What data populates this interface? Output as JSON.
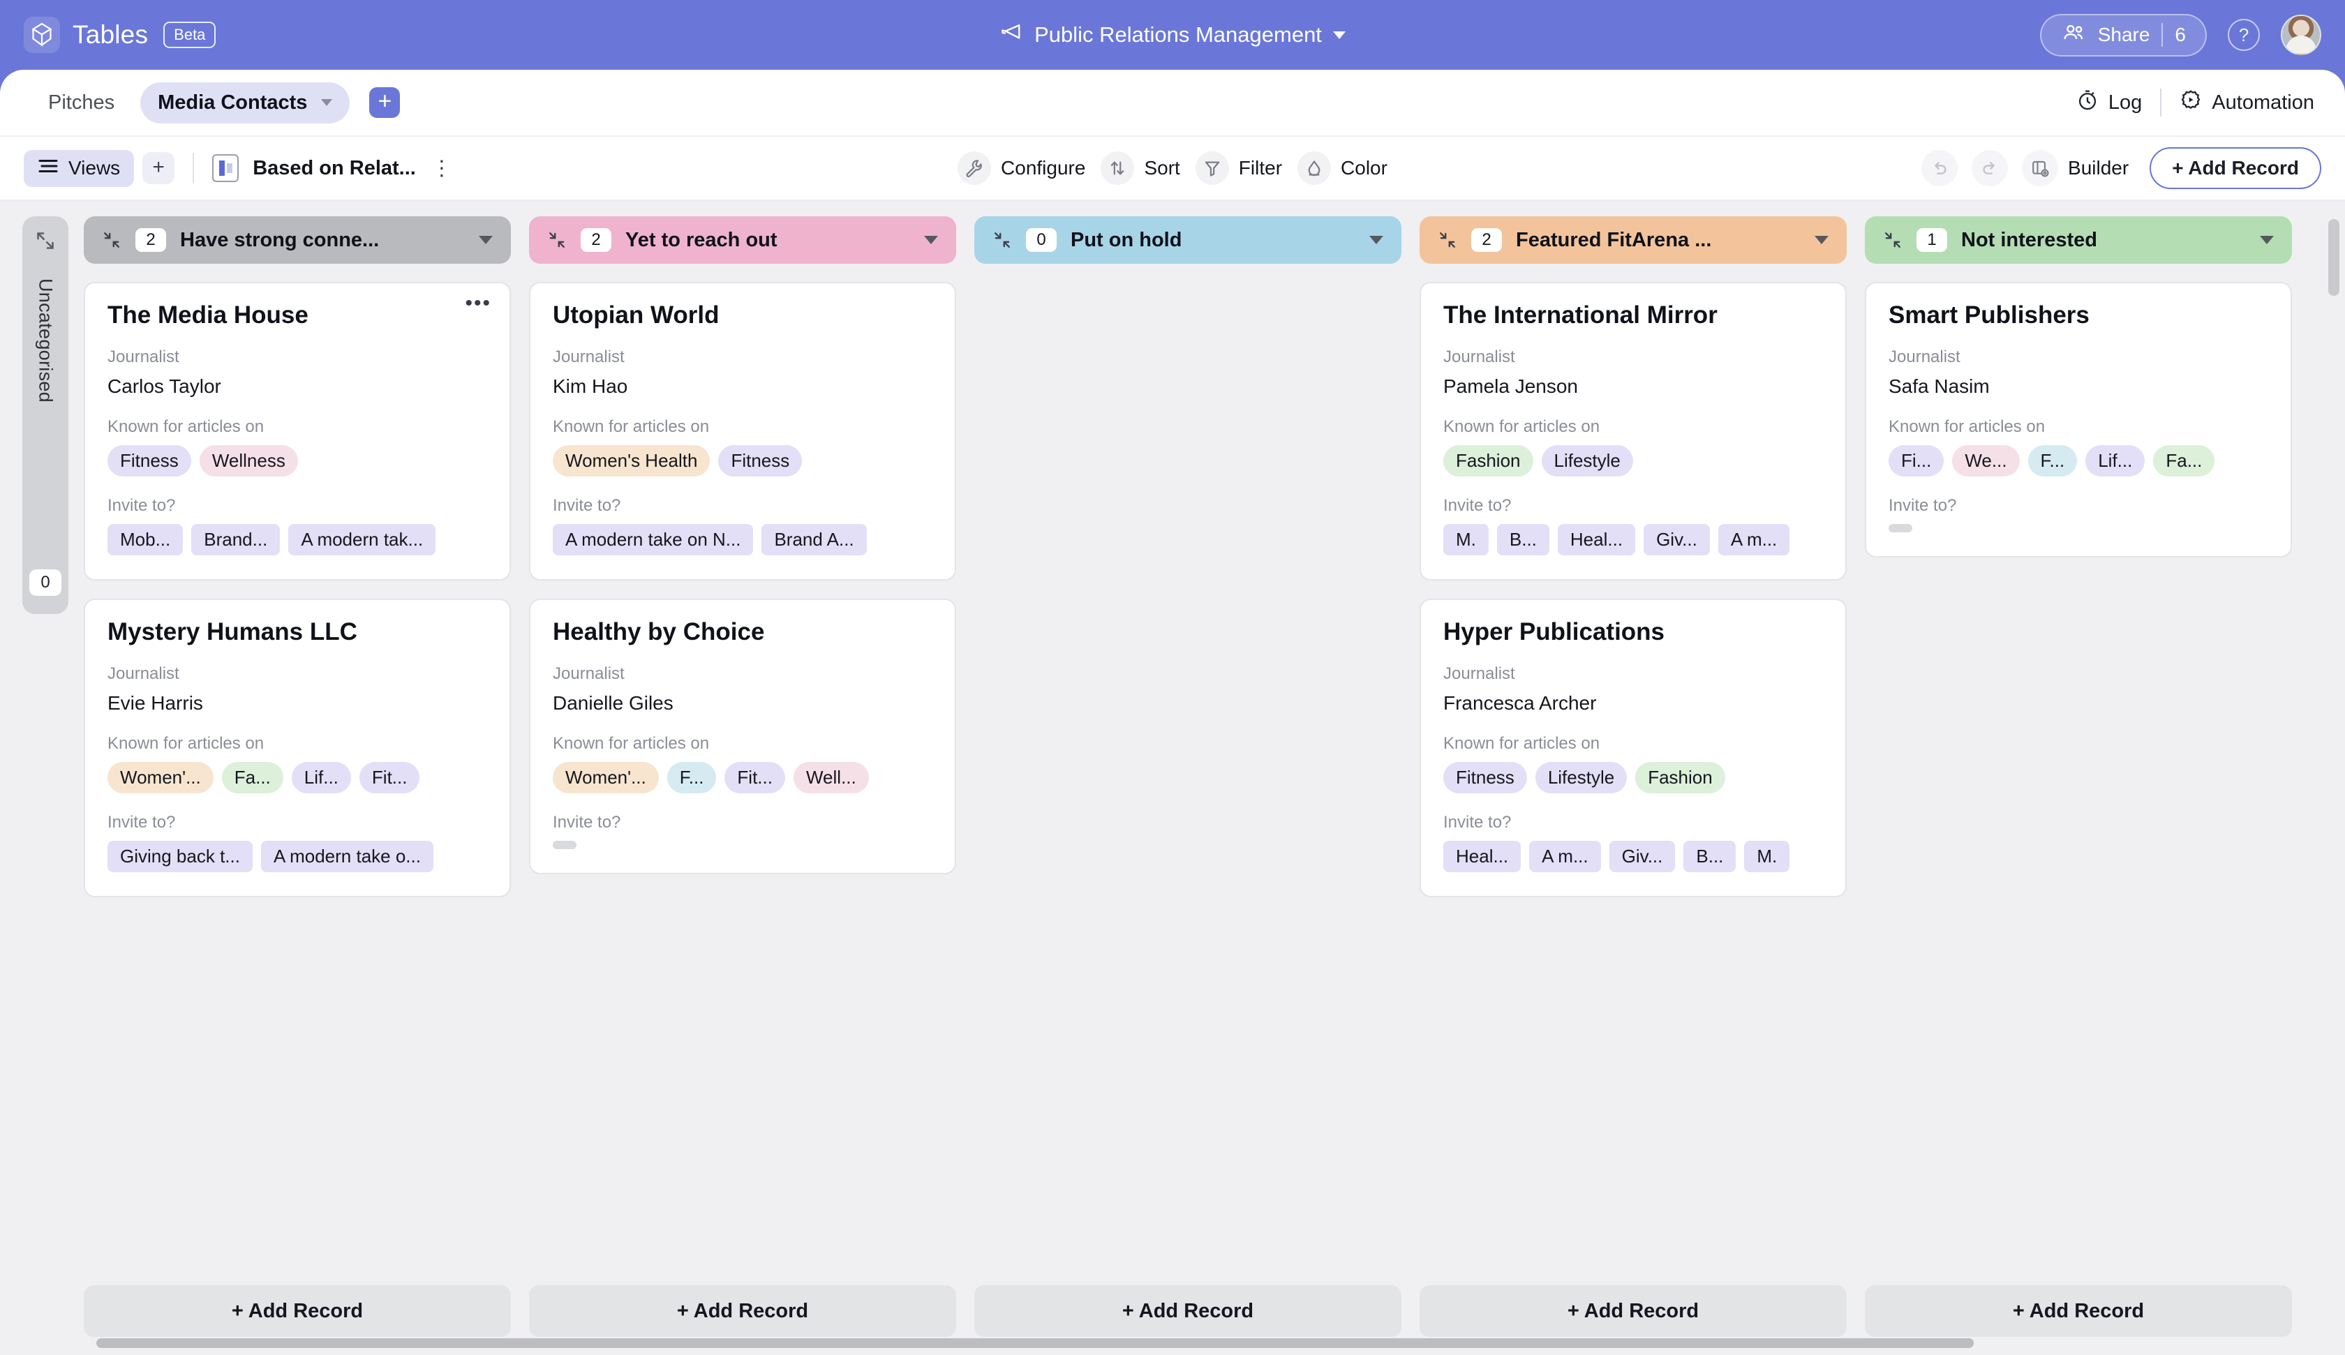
{
  "header": {
    "brand": "Tables",
    "beta": "Beta",
    "logo_icon": "cube-logo-icon",
    "doc_title": "Public Relations Management",
    "doc_icon": "megaphone-icon",
    "share_label": "Share",
    "share_count": "6",
    "share_icon": "people-icon",
    "help_icon": "question-mark-icon",
    "avatar_icon": "user-avatar"
  },
  "tabs": {
    "items": [
      {
        "label": "Pitches",
        "active": false
      },
      {
        "label": "Media Contacts",
        "active": true
      }
    ],
    "add_tab_icon": "plus-icon",
    "right": [
      {
        "label": "Log",
        "icon": "stopwatch-icon"
      },
      {
        "label": "Automation",
        "icon": "gear-play-icon"
      }
    ]
  },
  "toolbar": {
    "views_label": "Views",
    "views_icon": "hamburger-icon",
    "add_view_icon": "plus-icon",
    "current_view": "Based on Relat...",
    "view_icon": "kanban-icon",
    "view_menu_icon": "kebab-menu-icon",
    "center": [
      {
        "label": "Configure",
        "icon": "wrench-icon"
      },
      {
        "label": "Sort",
        "icon": "sort-arrows-icon"
      },
      {
        "label": "Filter",
        "icon": "funnel-icon"
      },
      {
        "label": "Color",
        "icon": "paint-drop-icon"
      }
    ],
    "undo_icon": "undo-arrow-icon",
    "redo_icon": "redo-arrow-icon",
    "builder_label": "Builder",
    "builder_icon": "builder-panel-icon",
    "add_record_label": "+ Add Record"
  },
  "board": {
    "add_record_label": "+ Add Record",
    "collapse_icon": "collapse-arrows-icon",
    "expand_icon": "expand-arrows-icon",
    "card_menu_icon": "ellipsis-icon",
    "collapsed_column": {
      "title": "Uncategorised",
      "count": "0"
    },
    "field_labels": {
      "journalist": "Journalist",
      "known_for": "Known for articles on",
      "invite_to": "Invite to?"
    },
    "columns": [
      {
        "title": "Have strong conne...",
        "count": "2",
        "color": "#b9babd",
        "cards": [
          {
            "title": "The Media House",
            "journalist": "Carlos Taylor",
            "known_for": [
              {
                "text": "Fitness",
                "color": "#e3dff7"
              },
              {
                "text": "Wellness",
                "color": "#f6e0e8"
              }
            ],
            "invite_to": [
              {
                "text": "Mob...",
                "color": "#e3dff7"
              },
              {
                "text": "Brand...",
                "color": "#e3dff7"
              },
              {
                "text": "A modern tak...",
                "color": "#e3dff7"
              }
            ]
          },
          {
            "title": "Mystery Humans LLC",
            "journalist": "Evie Harris",
            "known_for": [
              {
                "text": "Women'...",
                "color": "#f8e5cf"
              },
              {
                "text": "Fa...",
                "color": "#dcf0da"
              },
              {
                "text": "Lif...",
                "color": "#e3dff7"
              },
              {
                "text": "Fit...",
                "color": "#e3dff7"
              }
            ],
            "invite_to": [
              {
                "text": "Giving back t...",
                "color": "#e3dff7"
              },
              {
                "text": "A modern take o...",
                "color": "#e3dff7"
              }
            ]
          }
        ]
      },
      {
        "title": "Yet to reach out",
        "count": "2",
        "color": "#efb3cd",
        "cards": [
          {
            "title": "Utopian World",
            "journalist": "Kim Hao",
            "known_for": [
              {
                "text": "Women's Health",
                "color": "#f8e5cf"
              },
              {
                "text": "Fitness",
                "color": "#e3dff7"
              }
            ],
            "invite_to": [
              {
                "text": "A modern take on N...",
                "color": "#e3dff7"
              },
              {
                "text": "Brand A...",
                "color": "#e3dff7"
              }
            ]
          },
          {
            "title": "Healthy by Choice",
            "journalist": "Danielle Giles",
            "known_for": [
              {
                "text": "Women'...",
                "color": "#f8e5cf"
              },
              {
                "text": "F...",
                "color": "#d6eaf1"
              },
              {
                "text": "Fit...",
                "color": "#e3dff7"
              },
              {
                "text": "Well...",
                "color": "#f6e0e8"
              }
            ],
            "invite_to": []
          }
        ]
      },
      {
        "title": "Put on hold",
        "count": "0",
        "color": "#a8d4e8",
        "cards": []
      },
      {
        "title": "Featured FitArena ...",
        "count": "2",
        "color": "#f3c49b",
        "cards": [
          {
            "title": "The International Mirror",
            "journalist": "Pamela Jenson",
            "known_for": [
              {
                "text": "Fashion",
                "color": "#dcf0da"
              },
              {
                "text": "Lifestyle",
                "color": "#e3dff7"
              }
            ],
            "invite_to": [
              {
                "text": "M.",
                "color": "#e3dff7"
              },
              {
                "text": "B...",
                "color": "#e3dff7"
              },
              {
                "text": "Heal...",
                "color": "#e3dff7"
              },
              {
                "text": "Giv...",
                "color": "#e3dff7"
              },
              {
                "text": "A m...",
                "color": "#e3dff7"
              }
            ]
          },
          {
            "title": "Hyper Publications",
            "journalist": "Francesca Archer",
            "known_for": [
              {
                "text": "Fitness",
                "color": "#e3dff7"
              },
              {
                "text": "Lifestyle",
                "color": "#e3dff7"
              },
              {
                "text": "Fashion",
                "color": "#dcf0da"
              }
            ],
            "invite_to": [
              {
                "text": "Heal...",
                "color": "#e3dff7"
              },
              {
                "text": "A m...",
                "color": "#e3dff7"
              },
              {
                "text": "Giv...",
                "color": "#e3dff7"
              },
              {
                "text": "B...",
                "color": "#e3dff7"
              },
              {
                "text": "M.",
                "color": "#e3dff7"
              }
            ]
          }
        ]
      },
      {
        "title": "Not interested",
        "count": "1",
        "color": "#b4ddb4",
        "cards": [
          {
            "title": "Smart Publishers",
            "journalist": "Safa Nasim",
            "known_for": [
              {
                "text": "Fi...",
                "color": "#e3dff7"
              },
              {
                "text": "We...",
                "color": "#f6e0e8"
              },
              {
                "text": "F...",
                "color": "#d6eaf1"
              },
              {
                "text": "Lif...",
                "color": "#e3dff7"
              },
              {
                "text": "Fa...",
                "color": "#dcf0da"
              }
            ],
            "invite_to": []
          }
        ]
      }
    ]
  }
}
